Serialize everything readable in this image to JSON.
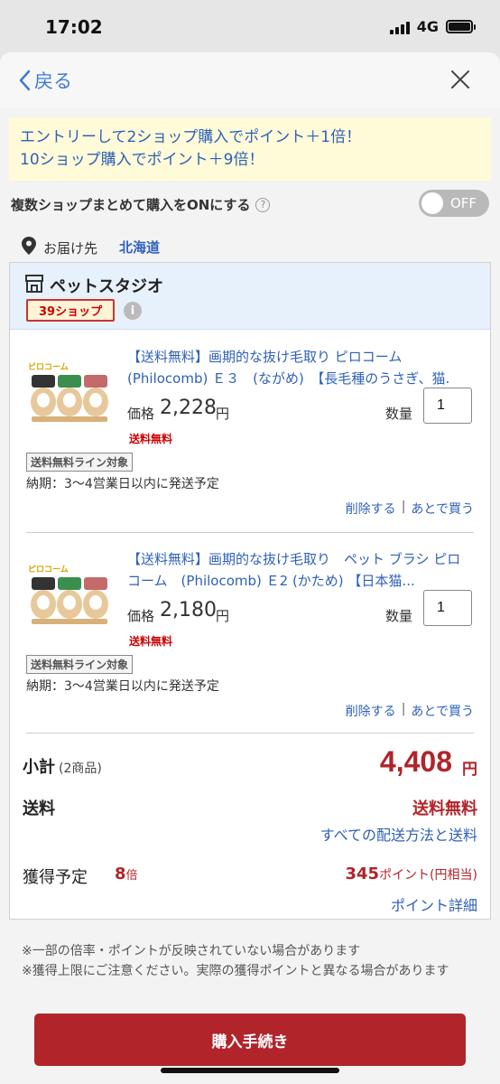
{
  "status": {
    "time": "17:02",
    "network": "4G"
  },
  "nav": {
    "back_label": "戻る"
  },
  "promo": {
    "line1": "エントリーして2ショップ購入でポイント＋1倍！",
    "line2": "10ショップ購入でポイント＋9倍！"
  },
  "toggle": {
    "label": "複数ショップまとめて購入をONにする",
    "state": "OFF"
  },
  "destination": {
    "label": "お届け先",
    "value": "北海道"
  },
  "shop": {
    "name": "ペットスタジオ",
    "badge": "39ショップ"
  },
  "items": [
    {
      "title": "【送料無料】画期的な抜け毛取り ピロコーム　(Philocomb) Ｅ３　(ながめ)　【長毛種のうさぎ、猫.",
      "price_label": "価格",
      "price": "2,228",
      "yen": "円",
      "shipping": "送料無料",
      "qty_label": "数量",
      "qty": "1",
      "line_badge": "送料無料ライン対象",
      "delivery": "納期：3〜4営業日以内に発送予定",
      "delete_label": "削除する",
      "later_label": "あとで買う"
    },
    {
      "title": "【送料無料】画期的な抜け毛取り　ペット ブラシ ピロコーム　(Philocomb) Ｅ2 (かため) 【日本猫...",
      "price_label": "価格",
      "price": "2,180",
      "yen": "円",
      "shipping": "送料無料",
      "qty_label": "数量",
      "qty": "1",
      "line_badge": "送料無料ライン対象",
      "delivery": "納期：3〜4営業日以内に発送予定",
      "delete_label": "削除する",
      "later_label": "あとで買う"
    }
  ],
  "summary": {
    "subtotal_label": "小計",
    "subtotal_count": "(2商品)",
    "subtotal_value": "4,408",
    "subtotal_yen": "円",
    "shipping_label": "送料",
    "shipping_value": "送料無料",
    "shipping_link": "すべての配送方法と送料",
    "points_label": "獲得予定",
    "points_mult": "8",
    "points_mult_unit": "倍",
    "points_value": "345",
    "points_unit": "ポイント(円相当)",
    "points_link": "ポイント詳細"
  },
  "notes": {
    "line1": "※一部の倍率・ポイントが反映されていない場合があります",
    "line2": "※獲得上限にご注意ください。実際の獲得ポイントと異なる場合があります"
  },
  "buy_button": "購入手続き",
  "colors": {
    "accent_red": "#b1242a",
    "link_blue": "#2f61b8",
    "promo_bg": "#fffbd8"
  }
}
